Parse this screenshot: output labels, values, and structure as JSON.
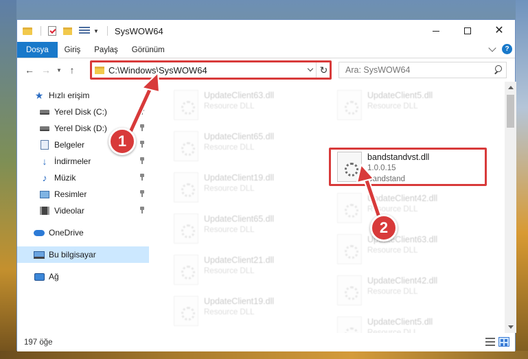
{
  "window": {
    "title": "SysWOW64"
  },
  "ribbon": {
    "tabs": [
      "Dosya",
      "Giriş",
      "Paylaş",
      "Görünüm"
    ]
  },
  "address": {
    "path": "C:\\Windows\\SysWOW64"
  },
  "search": {
    "placeholder": "Ara: SysWOW64"
  },
  "sidebar": {
    "items": [
      {
        "label": "Hızlı erişim",
        "icon": "star-icon"
      },
      {
        "label": "Yerel Disk (C:)",
        "icon": "drive-icon",
        "pinned": true
      },
      {
        "label": "Yerel Disk (D:)",
        "icon": "drive-icon",
        "pinned": true
      },
      {
        "label": "Belgeler",
        "icon": "documents-icon",
        "pinned": true
      },
      {
        "label": "İndirmeler",
        "icon": "download-icon",
        "pinned": true
      },
      {
        "label": "Müzik",
        "icon": "music-icon",
        "pinned": true
      },
      {
        "label": "Resimler",
        "icon": "pictures-icon",
        "pinned": true
      },
      {
        "label": "Videolar",
        "icon": "videos-icon",
        "pinned": true
      },
      {
        "label": "OneDrive",
        "icon": "onedrive-icon"
      },
      {
        "label": "Bu bilgisayar",
        "icon": "computer-icon",
        "selected": true
      },
      {
        "label": "Ağ",
        "icon": "network-icon"
      }
    ]
  },
  "files": {
    "left": [
      {
        "name": "UpdateClient63.dll",
        "line2": "Resource DLL"
      },
      {
        "name": "UpdateClient65.dll",
        "line2": "Resource DLL"
      },
      {
        "name": "UpdateClient19.dll",
        "line2": "Resource DLL"
      },
      {
        "name": "UpdateClient65.dll",
        "line2": "Resource DLL"
      },
      {
        "name": "UpdateClient21.dll",
        "line2": "Resource DLL"
      },
      {
        "name": "UpdateClient19.dll",
        "line2": "Resource DLL"
      }
    ],
    "right": [
      {
        "name": "UpdateClient5.dll",
        "line2": "Resource DLL"
      },
      {
        "name": "bandstandvst.dll",
        "line2": "1.0.0.15",
        "line3": "Bandstand"
      },
      {
        "name": "UpdateClient42.dll",
        "line2": "Resource DLL"
      },
      {
        "name": "UpdateClient63.dll",
        "line2": "Resource DLL"
      },
      {
        "name": "UpdateClient42.dll",
        "line2": "Resource DLL"
      },
      {
        "name": "UpdateClient5.dll",
        "line2": "Resource DLL"
      }
    ]
  },
  "status": {
    "count": "197 öğe"
  },
  "annotations": {
    "step1": "1",
    "step2": "2",
    "color": "#d83a3a"
  }
}
